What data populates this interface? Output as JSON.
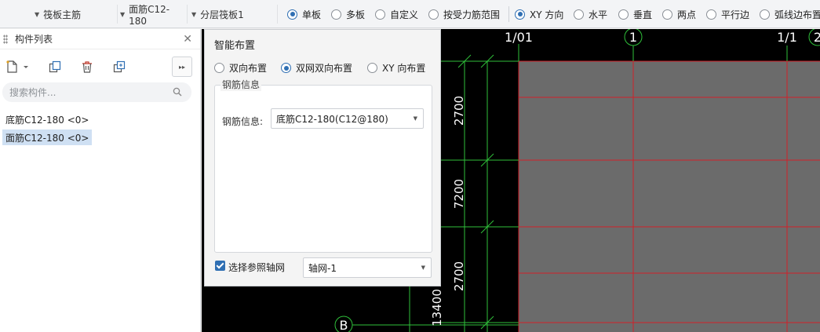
{
  "toolbar": {
    "dropdowns": [
      {
        "label": "筏板主筋"
      },
      {
        "label": "面筋C12-180"
      },
      {
        "label": "分层筏板1"
      }
    ],
    "layout_radios": [
      {
        "label": "单板",
        "checked": true
      },
      {
        "label": "多板",
        "checked": false
      },
      {
        "label": "自定义",
        "checked": false
      },
      {
        "label": "按受力筋范围",
        "checked": false
      }
    ],
    "direction_radios": [
      {
        "label": "XY 方向",
        "checked": true
      },
      {
        "label": "水平",
        "checked": false
      },
      {
        "label": "垂直",
        "checked": false
      },
      {
        "label": "两点",
        "checked": false
      },
      {
        "label": "平行边",
        "checked": false
      },
      {
        "label": "弧线边布置",
        "checked": false
      }
    ]
  },
  "panel": {
    "title": "构件列表",
    "search_placeholder": "搜索构件...",
    "items": [
      {
        "label": "底筋C12-180 <0>",
        "selected": false
      },
      {
        "label": "面筋C12-180 <0>",
        "selected": true
      }
    ]
  },
  "dialog": {
    "title": "智能布置",
    "radios": [
      {
        "label": "双向布置",
        "checked": false
      },
      {
        "label": "双网双向布置",
        "checked": true
      },
      {
        "label": "XY 向布置",
        "checked": false
      }
    ],
    "group_title": "钢筋信息",
    "rebar_label": "钢筋信息:",
    "rebar_value": "底筋C12-180(C12@180)",
    "axis_checkbox_label": "选择参照轴网",
    "axis_checked": true,
    "axis_value": "轴网-1"
  },
  "drawing": {
    "axis_labels": [
      "1/01",
      "1",
      "1/1",
      "2"
    ],
    "row_axis_label": "B",
    "dimensions": [
      "2700",
      "7200",
      "2700",
      "13400"
    ],
    "colors": {
      "background": "#000000",
      "slab_fill": "#6b6b6b",
      "red_lines": "#d0202a",
      "green_lines": "#2fbf3a",
      "text": "#ffffff"
    }
  }
}
